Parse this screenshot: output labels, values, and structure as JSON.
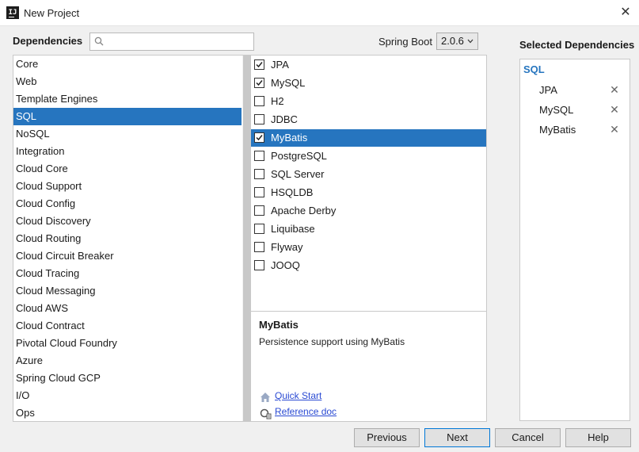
{
  "window": {
    "title": "New Project",
    "close_glyph": "✕"
  },
  "toolbar": {
    "dependencies_label": "Dependencies",
    "search_value": "",
    "search_placeholder": "",
    "spring_boot_label": "Spring Boot",
    "spring_boot_version": "2.0.6"
  },
  "categories": [
    {
      "label": "Core",
      "selected": false
    },
    {
      "label": "Web",
      "selected": false
    },
    {
      "label": "Template Engines",
      "selected": false
    },
    {
      "label": "SQL",
      "selected": true
    },
    {
      "label": "NoSQL",
      "selected": false
    },
    {
      "label": "Integration",
      "selected": false
    },
    {
      "label": "Cloud Core",
      "selected": false
    },
    {
      "label": "Cloud Support",
      "selected": false
    },
    {
      "label": "Cloud Config",
      "selected": false
    },
    {
      "label": "Cloud Discovery",
      "selected": false
    },
    {
      "label": "Cloud Routing",
      "selected": false
    },
    {
      "label": "Cloud Circuit Breaker",
      "selected": false
    },
    {
      "label": "Cloud Tracing",
      "selected": false
    },
    {
      "label": "Cloud Messaging",
      "selected": false
    },
    {
      "label": "Cloud AWS",
      "selected": false
    },
    {
      "label": "Cloud Contract",
      "selected": false
    },
    {
      "label": "Pivotal Cloud Foundry",
      "selected": false
    },
    {
      "label": "Azure",
      "selected": false
    },
    {
      "label": "Spring Cloud GCP",
      "selected": false
    },
    {
      "label": "I/O",
      "selected": false
    },
    {
      "label": "Ops",
      "selected": false
    }
  ],
  "dependencies": [
    {
      "label": "JPA",
      "checked": true,
      "selected": false
    },
    {
      "label": "MySQL",
      "checked": true,
      "selected": false
    },
    {
      "label": "H2",
      "checked": false,
      "selected": false
    },
    {
      "label": "JDBC",
      "checked": false,
      "selected": false
    },
    {
      "label": "MyBatis",
      "checked": true,
      "selected": true
    },
    {
      "label": "PostgreSQL",
      "checked": false,
      "selected": false
    },
    {
      "label": "SQL Server",
      "checked": false,
      "selected": false
    },
    {
      "label": "HSQLDB",
      "checked": false,
      "selected": false
    },
    {
      "label": "Apache Derby",
      "checked": false,
      "selected": false
    },
    {
      "label": "Liquibase",
      "checked": false,
      "selected": false
    },
    {
      "label": "Flyway",
      "checked": false,
      "selected": false
    },
    {
      "label": "JOOQ",
      "checked": false,
      "selected": false
    }
  ],
  "description": {
    "title": "MyBatis",
    "text": "Persistence support using MyBatis",
    "quick_start": "Quick Start",
    "reference_doc": "Reference doc"
  },
  "selected_panel": {
    "title": "Selected Dependencies",
    "group": "SQL",
    "items": [
      "JPA",
      "MySQL",
      "MyBatis"
    ],
    "remove_glyph": "✕"
  },
  "buttons": {
    "previous": "Previous",
    "next": "Next",
    "cancel": "Cancel",
    "help": "Help"
  },
  "colors": {
    "accent": "#2675bf",
    "link": "#2a4ad3"
  }
}
